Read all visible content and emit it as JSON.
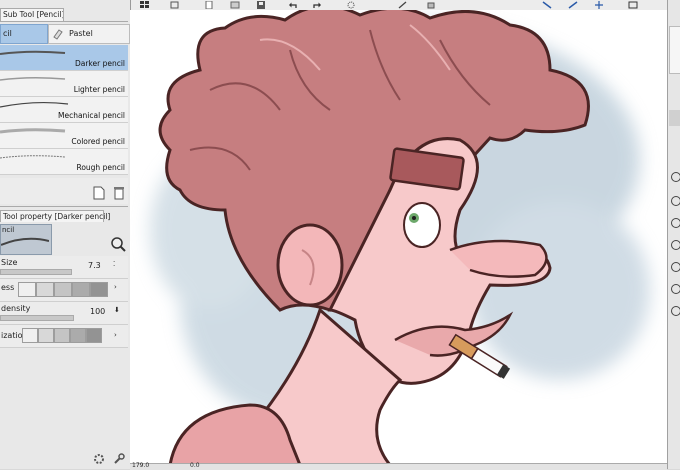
{
  "left_panel": {
    "subtool_header": "Sub Tool [Pencil]",
    "tabs": [
      {
        "label": "cil",
        "selected": true
      },
      {
        "label": "Pastel",
        "selected": false
      }
    ],
    "brushes": [
      {
        "label": "Darker pencil",
        "selected": true
      },
      {
        "label": "Lighter pencil",
        "selected": false
      },
      {
        "label": "Mechanical pencil",
        "selected": false
      },
      {
        "label": "Colored pencil",
        "selected": false
      },
      {
        "label": "Rough pencil",
        "selected": false
      }
    ],
    "tool_property_header": "Tool property [Darker pencil]",
    "preview_label": "ncil",
    "size": {
      "label": "Size",
      "value": "7.3"
    },
    "hardness_label": "ess",
    "density": {
      "label": "density",
      "value": "100"
    },
    "stabilization_label": "ization"
  },
  "status_bar": {
    "zoom": "179.0",
    "angle": "0.0"
  },
  "colors": {
    "panel_bg": "#e8e8e8",
    "selection": "#a9c8e8",
    "hair": "#c67e80",
    "skin": "#f7c9ca",
    "outline": "#4a2424"
  }
}
